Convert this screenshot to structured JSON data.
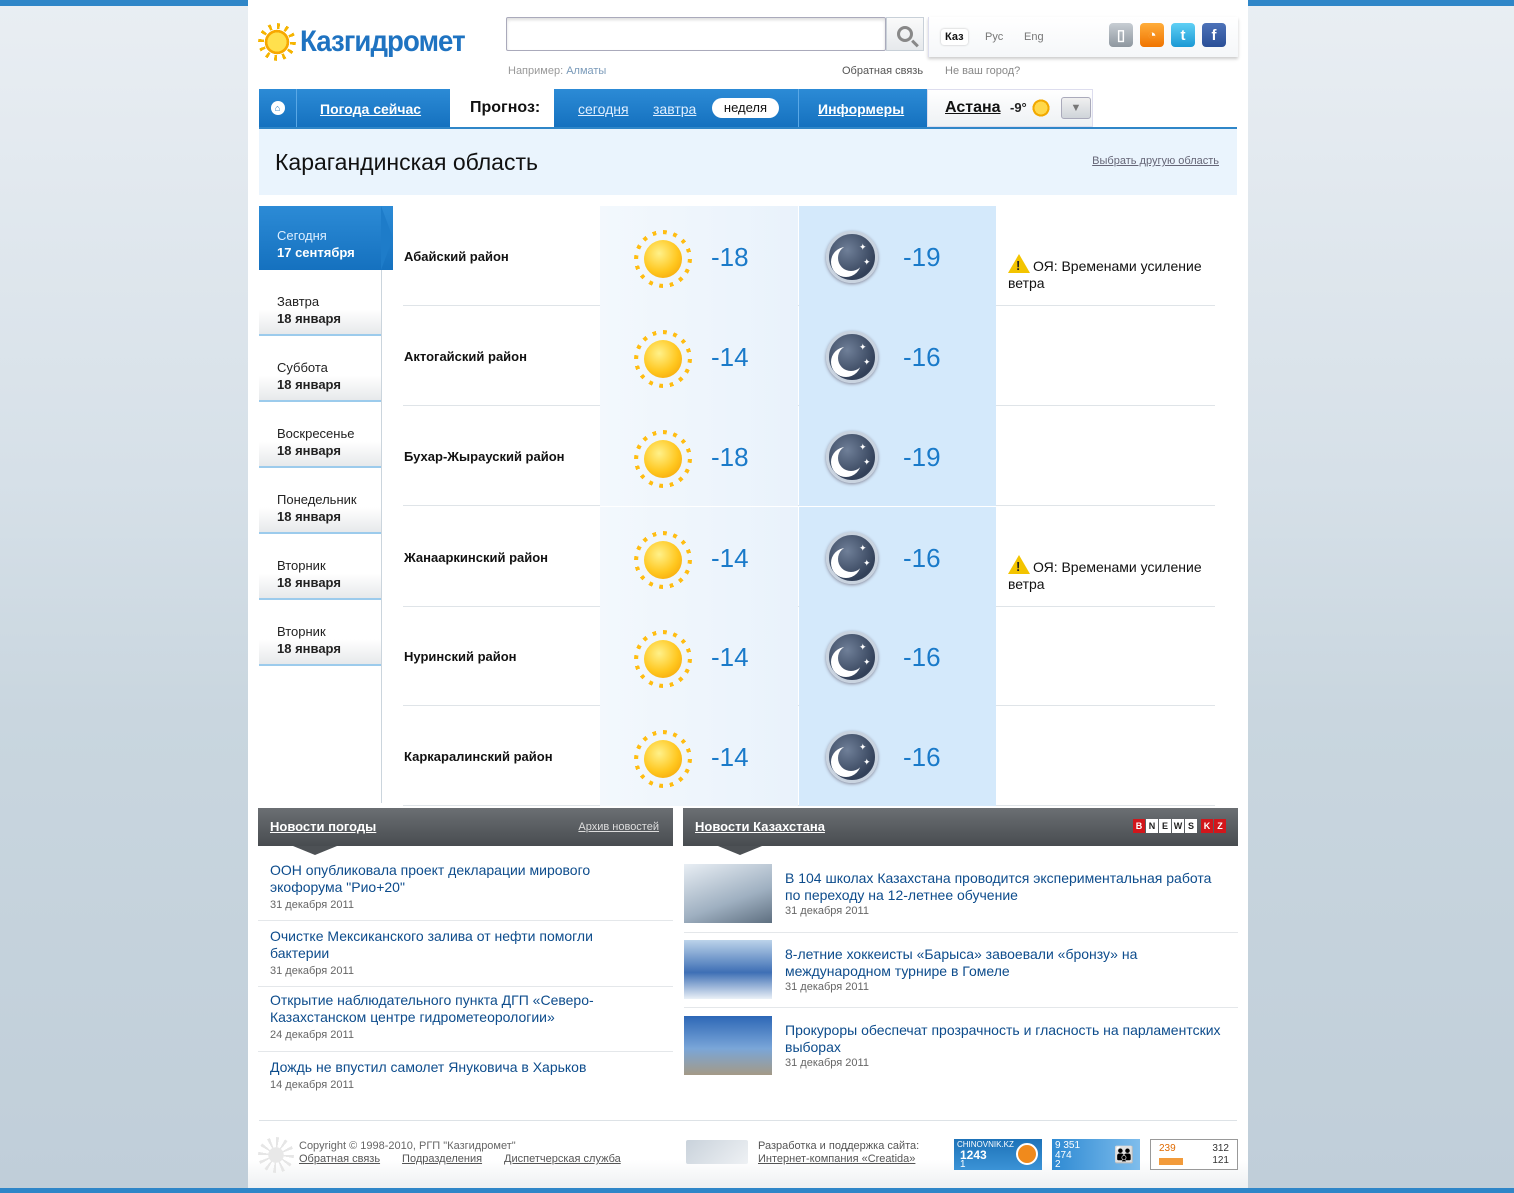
{
  "logo": {
    "name": "Казгидромет"
  },
  "search": {
    "placeholder": "",
    "hint_label": "Например:",
    "hint_city": "Алматы",
    "feedback": "Обратная связь",
    "not_your_city": "Не ваш город?"
  },
  "languages": [
    "Каз",
    "Рус",
    "Eng"
  ],
  "social": [
    "mobile-icon",
    "rss-icon",
    "twitter-icon",
    "facebook-icon"
  ],
  "nav": {
    "now": "Погода сейчас",
    "forecast": "Прогноз:",
    "today": "сегодня",
    "tomorrow": "завтра",
    "week": "неделя",
    "informers": "Информеры",
    "city": "Астана",
    "city_temp": "-9°"
  },
  "region": {
    "title": "Карагандинская область",
    "choose_other": "Выбрать другую область"
  },
  "days": [
    {
      "day": "Сегодня",
      "date": "17 сентября"
    },
    {
      "day": "Завтра",
      "date": "18 января"
    },
    {
      "day": "Суббота",
      "date": "18 января"
    },
    {
      "day": "Воскресенье",
      "date": "18 января"
    },
    {
      "day": "Понедельник",
      "date": "18 января"
    },
    {
      "day": "Вторник",
      "date": "18 января"
    },
    {
      "day": "Вторник",
      "date": "18 января"
    }
  ],
  "forecast": [
    {
      "district": "Абайский район",
      "day_temp": "-18",
      "night_temp": "-19",
      "warning": "ОЯ: Временами усиление ветра"
    },
    {
      "district": "Актогайский район",
      "day_temp": "-14",
      "night_temp": "-16",
      "warning": ""
    },
    {
      "district": "Бухар-Жырауский район",
      "day_temp": "-18",
      "night_temp": "-19",
      "warning": ""
    },
    {
      "district": "Жанааркинский район",
      "day_temp": "-14",
      "night_temp": "-16",
      "warning": "ОЯ: Временами усиление ветра"
    },
    {
      "district": "Нуринский район",
      "day_temp": "-14",
      "night_temp": "-16",
      "warning": ""
    },
    {
      "district": "Каркаралинский район",
      "day_temp": "-14",
      "night_temp": "-16",
      "warning": ""
    }
  ],
  "weather_news": {
    "title": "Новости погоды",
    "archive": "Архив новостей",
    "items": [
      {
        "title": "ООН опубликовала проект декларации мирового экофорума \"Рио+20\"",
        "date": "31 декабря 2011"
      },
      {
        "title": "Очистке Мексиканского залива от нефти помогли бактерии",
        "date": "31 декабря 2011"
      },
      {
        "title": "Открытие наблюдательного пункта ДГП «Северо-Казахстанском центре гидрометеорологии»",
        "date": "24 декабря 2011"
      },
      {
        "title": "Дождь не впустил самолет Януковича в Харьков",
        "date": "14 декабря 2011"
      }
    ]
  },
  "kz_news": {
    "title": "Новости Казахстана",
    "brand": [
      "B",
      "N",
      "E",
      "W",
      "S",
      "K",
      "Z"
    ],
    "items": [
      {
        "title": "В 104 школах Казахстана проводится экспериментальная работа по переходу на 12-летнее обучение",
        "date": "31 декабря 2011"
      },
      {
        "title": "8-летние хоккеисты «Барыса» завоевали «бронзу» на международном турнире в Гомеле",
        "date": "31 декабря 2011"
      },
      {
        "title": "Прокуроры обеспечат прозрачность и гласность на парламентских выборах",
        "date": "31 декабря 2011"
      }
    ]
  },
  "footer": {
    "copyright": "Copyright © 1998-2010, РГП \"Казгидромет\"",
    "links": [
      "Обратная связь",
      "Подразделения",
      "Диспетчерская служба"
    ],
    "dev_label": "Разработка и поддержка сайта:",
    "dev_link": "Интернет-компания «Creatida»"
  },
  "counters": {
    "c1_title": "CHINOVNIK.KZ",
    "c1_a": "1243",
    "c1_b": "1",
    "c2_a": "9 351",
    "c2_b": "474",
    "c2_c": "2",
    "c3_a": "239",
    "c3_b": "312",
    "c3_c": "121"
  },
  "colors": {
    "accent": "#1571bf",
    "temp": "#1a7ac9",
    "news_header": "#484c50"
  }
}
